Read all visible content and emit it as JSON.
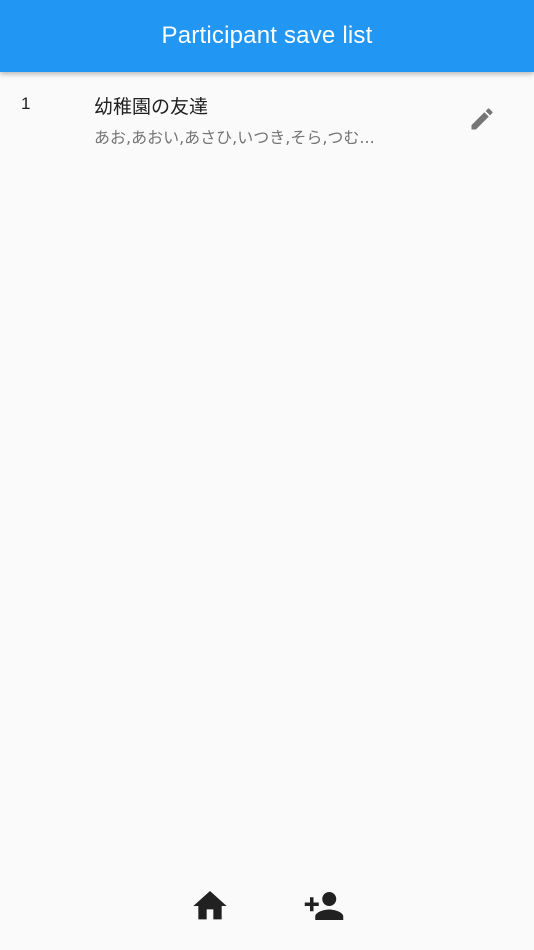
{
  "appbar": {
    "title": "Participant save list",
    "color": "#2196f3"
  },
  "list": {
    "items": [
      {
        "index": "1",
        "title": "幼稚園の友達",
        "subtitle": "あお,あおい,あさひ,いつき,そら,つむ...",
        "action_icon": "edit-icon"
      }
    ]
  },
  "bottom_nav": {
    "items": [
      {
        "icon": "home-icon"
      },
      {
        "icon": "person-add-icon"
      }
    ]
  }
}
